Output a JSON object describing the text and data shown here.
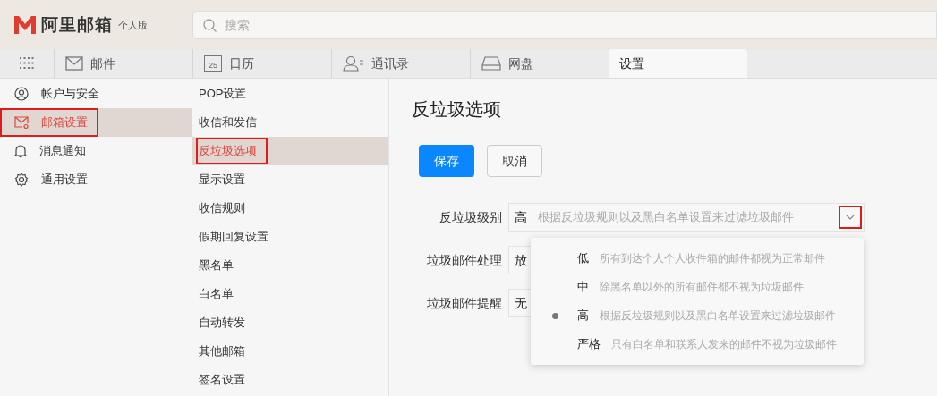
{
  "logo": {
    "name": "阿里邮箱",
    "edition": "个人版"
  },
  "search": {
    "placeholder": "搜索"
  },
  "tabs": [
    {
      "label": "邮件",
      "kind": "mail",
      "selected": false
    },
    {
      "label": "日历",
      "kind": "calendar",
      "icon_text": "25",
      "selected": false
    },
    {
      "label": "通讯录",
      "kind": "contacts",
      "selected": false
    },
    {
      "label": "网盘",
      "kind": "drive",
      "selected": false
    },
    {
      "label": "设置",
      "kind": "plain",
      "selected": true
    }
  ],
  "sidebar": {
    "items": [
      {
        "label": "帐户与安全",
        "kind": "account",
        "selected": false,
        "highlighted": false
      },
      {
        "label": "邮箱设置",
        "kind": "mailbox",
        "selected": true,
        "highlighted": true
      },
      {
        "label": "消息通知",
        "kind": "notification",
        "selected": false,
        "highlighted": false
      },
      {
        "label": "通用设置",
        "kind": "general",
        "selected": false,
        "highlighted": false
      }
    ]
  },
  "submenu": {
    "items": [
      {
        "label": "POP设置",
        "selected": false,
        "highlighted": false
      },
      {
        "label": "收信和发信",
        "selected": false,
        "highlighted": false
      },
      {
        "label": "反垃圾选项",
        "selected": true,
        "highlighted": true
      },
      {
        "label": "显示设置",
        "selected": false,
        "highlighted": false
      },
      {
        "label": "收信规则",
        "selected": false,
        "highlighted": false
      },
      {
        "label": "假期回复设置",
        "selected": false,
        "highlighted": false
      },
      {
        "label": "黑名单",
        "selected": false,
        "highlighted": false
      },
      {
        "label": "白名单",
        "selected": false,
        "highlighted": false
      },
      {
        "label": "自动转发",
        "selected": false,
        "highlighted": false
      },
      {
        "label": "其他邮箱",
        "selected": false,
        "highlighted": false
      },
      {
        "label": "签名设置",
        "selected": false,
        "highlighted": false
      }
    ]
  },
  "content": {
    "title": "反垃圾选项",
    "buttons": [
      {
        "label": "保存",
        "kind": "primary"
      },
      {
        "label": "取消",
        "kind": "secondary"
      }
    ],
    "fields": [
      {
        "label": "反垃圾级别",
        "value": "高",
        "description": "根据反垃圾规则以及黑白名单设置来过滤垃圾邮件",
        "toggle_highlighted": true
      },
      {
        "label": "垃圾邮件处理",
        "value": "放"
      },
      {
        "label": "垃圾邮件提醒",
        "value": "无"
      }
    ],
    "dropdown": {
      "options": [
        {
          "label": "低",
          "description": "所有到达个人个人收件箱的邮件都视为正常邮件",
          "selected": false
        },
        {
          "label": "中",
          "description": "除黑名单以外的所有邮件都不视为垃圾邮件",
          "selected": false
        },
        {
          "label": "高",
          "description": "根据反垃圾规则以及黑白名单设置来过滤垃圾邮件",
          "selected": true
        },
        {
          "label": "严格",
          "description": "只有白名单和联系人发来的邮件不视为垃圾邮件",
          "selected": false
        }
      ]
    }
  }
}
